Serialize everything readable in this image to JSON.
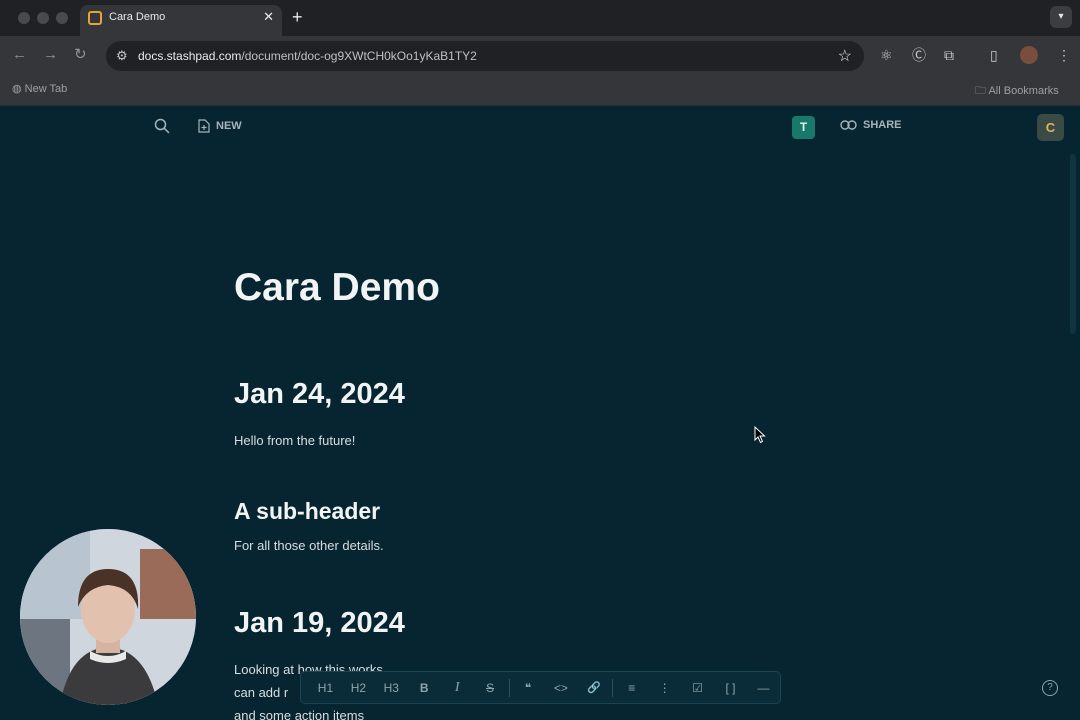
{
  "browser": {
    "tab": {
      "title": "Cara Demo",
      "close": "✕"
    },
    "new_tab": "+",
    "url_host": "docs.stashpad.com",
    "url_path": "/document/doc-og9XWtCH0kOo1yKaB1TY2",
    "bookmarks": {
      "new_tab": "New Tab",
      "all_bookmarks": "All Bookmarks"
    }
  },
  "app": {
    "new_label": "NEW",
    "share_label": "SHARE",
    "collab_avatar": "T",
    "user_avatar": "C"
  },
  "document": {
    "title": "Cara Demo",
    "sections": [
      {
        "heading": "Jan 24, 2024",
        "body": "Hello from the future!"
      },
      {
        "heading": "A sub-header",
        "body": "For all those other details."
      },
      {
        "heading": "Jan 19, 2024",
        "lines": [
          "Looking at how this works",
          "can add r",
          "and some action items"
        ]
      }
    ]
  },
  "format_toolbar": {
    "h1": "H1",
    "h2": "H2",
    "h3": "H3",
    "bold": "B",
    "italic": "I",
    "strike": "S",
    "quote": "❝",
    "code": "<>",
    "link": "🔗",
    "bullets": "≡",
    "numbered": "⋮",
    "checklist": "☑",
    "codeblock": "[ ]",
    "divider": "―"
  },
  "help": "?",
  "colors": {
    "page_bg": "#072530",
    "accent_teal": "#17796a",
    "user_avatar_text": "#e8b25a"
  }
}
